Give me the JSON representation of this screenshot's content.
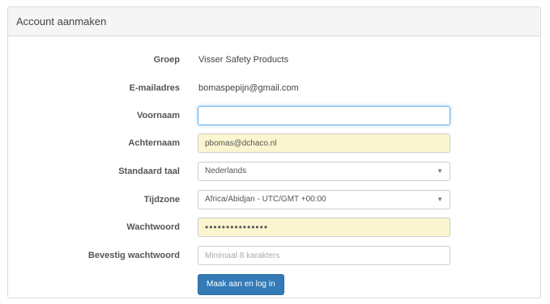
{
  "panel": {
    "title": "Account aanmaken"
  },
  "form": {
    "group": {
      "label": "Groep",
      "value": "Visser Safety Products"
    },
    "email": {
      "label": "E-mailadres",
      "value": "bomaspepijn@gmail.com"
    },
    "firstname": {
      "label": "Voornaam",
      "value": ""
    },
    "lastname": {
      "label": "Achternaam",
      "value": "pbomas@dchaco.nl"
    },
    "language": {
      "label": "Standaard taal",
      "selected": "Nederlands"
    },
    "timezone": {
      "label": "Tijdzone",
      "selected": "Africa/Abidjan - UTC/GMT +00:00"
    },
    "password": {
      "label": "Wachtwoord",
      "value": "•••••••••••••••"
    },
    "confirm_password": {
      "label": "Bevestig wachtwoord",
      "placeholder": "Minimaal 8 karakters"
    },
    "submit_label": "Maak aan en log in"
  },
  "colors": {
    "accent": "#337ab7",
    "autofill": "#fbf6cf",
    "focus_border": "#66afe9"
  }
}
